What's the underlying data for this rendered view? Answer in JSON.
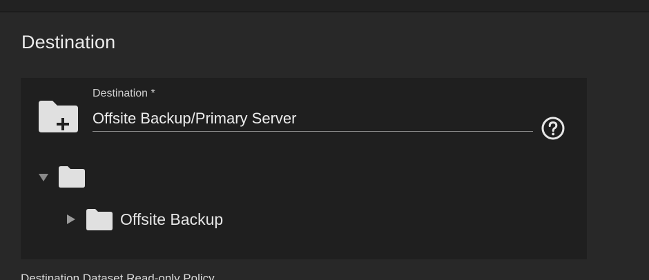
{
  "section": {
    "title": "Destination"
  },
  "destination_field": {
    "label": "Destination *",
    "value": "Offsite Backup/Primary Server"
  },
  "icons": {
    "add_folder": "folder-plus-icon",
    "help": "help-circle-icon",
    "expanded": "triangle-down-icon",
    "collapsed": "triangle-right-icon",
    "folder": "folder-icon"
  },
  "tree": {
    "root": {
      "label": "",
      "expanded": true
    },
    "children": [
      {
        "label": "Offsite Backup",
        "expanded": false
      }
    ]
  },
  "next_field": {
    "label": "Destination Dataset Read-only Policy"
  },
  "colors": {
    "background": "#282828",
    "panel": "#1f1f1f",
    "icon": "#e0e0e0"
  }
}
